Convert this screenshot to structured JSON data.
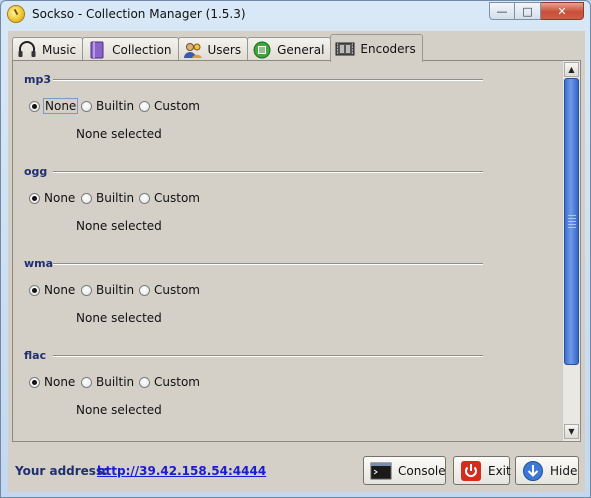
{
  "window": {
    "title": "Sockso - Collection Manager (1.5.3)"
  },
  "tabs": [
    {
      "label": "Music",
      "icon": "headphones-icon"
    },
    {
      "label": "Collection",
      "icon": "book-icon"
    },
    {
      "label": "Users",
      "icon": "users-icon"
    },
    {
      "label": "General",
      "icon": "general-icon"
    },
    {
      "label": "Encoders",
      "icon": "film-icon",
      "active": true
    }
  ],
  "encoders": [
    {
      "name": "mp3",
      "options": [
        "None",
        "Builtin",
        "Custom"
      ],
      "selected": "None",
      "status": "None selected"
    },
    {
      "name": "ogg",
      "options": [
        "None",
        "Builtin",
        "Custom"
      ],
      "selected": "None",
      "status": "None selected"
    },
    {
      "name": "wma",
      "options": [
        "None",
        "Builtin",
        "Custom"
      ],
      "selected": "None",
      "status": "None selected"
    },
    {
      "name": "flac",
      "options": [
        "None",
        "Builtin",
        "Custom"
      ],
      "selected": "None",
      "status": "None selected"
    }
  ],
  "footer": {
    "address_label": "Your address:",
    "address_url": "http://39.42.158.54:4444",
    "console_label": "Console",
    "exit_label": "Exit",
    "hide_label": "Hide"
  },
  "colors": {
    "section_title": "#1f2f6f",
    "link": "#1b1bd1",
    "scroll_thumb": "#4a7bdc"
  }
}
